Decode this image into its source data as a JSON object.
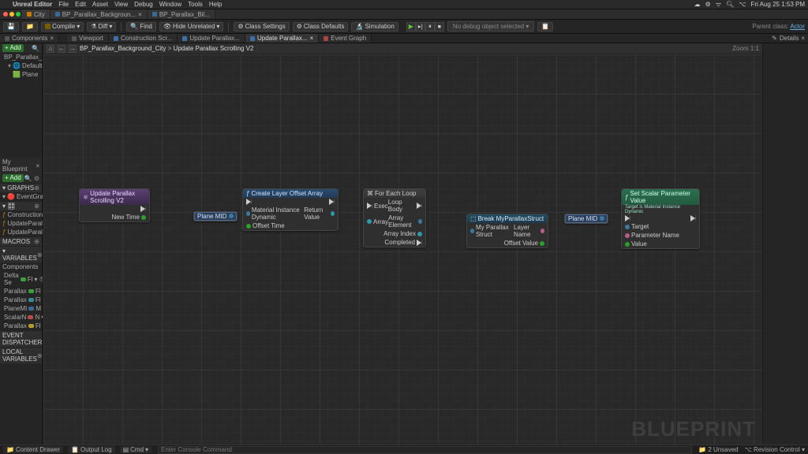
{
  "menubar": {
    "app": "Unreal Editor",
    "items": [
      "File",
      "Edit",
      "Asset",
      "View",
      "Debug",
      "Window",
      "Tools",
      "Help"
    ],
    "right_time": "Fri Aug 25  1:53 PM"
  },
  "tabs": {
    "project": "City",
    "doc1": "BP_Parallax_Backgroun...",
    "doc2": "BP_Parallax_Bil..."
  },
  "toolbar2": {
    "compile": "Compile",
    "diff": "Diff",
    "find": "Find",
    "hide": "Hide Unrelated",
    "class_settings": "Class Settings",
    "class_defaults": "Class Defaults",
    "simulation": "Simulation",
    "dropdown": "No debug object selected",
    "parent_label": "Parent class:",
    "parent_link": "Actor"
  },
  "row_tabs": {
    "components": "Components",
    "viewport": "Viewport",
    "construction": "Construction Scr...",
    "update1": "Update Parallax...",
    "update2": "Update Parallax...",
    "event_graph": "Event Graph",
    "details": "Details"
  },
  "left": {
    "add": "Add",
    "components_hdr": "Components",
    "comp_root": "BP_Parallax_Bac",
    "comp_default": "DefaultScene",
    "comp_plane": "Plane",
    "my_bp": "My Blueprint",
    "cat_graphs": "GRAPHS",
    "graphs_event": "EventGraph",
    "graphs_f": "f",
    "f_construct": "ConstructionSc",
    "f_update1": "UpdateParallax",
    "f_update2": "UpdateParallax",
    "cat_macros": "MACROS",
    "cat_vars": "VARIABLES",
    "cat_comp": "Components",
    "v1": "Delta Se",
    "v2": "Parallax",
    "v3": "Parallax",
    "v4": "PlaneMI",
    "v5": "ScalarN",
    "v6": "Parallax",
    "v1t": "Fl",
    "v2t": "Fl",
    "v3t": "Fl",
    "v4t": "M",
    "v5t": "N",
    "v6t": "Fl",
    "event_dispatch": "EVENT DISPATCHERS",
    "local_vars": "LOCAL VARIABLES"
  },
  "breadcrumb": {
    "root": "BP_Parallax_Background_City",
    "sep": ">",
    "func": "Update Parallax Scrolling V2",
    "zoom": "Zoom 1:1"
  },
  "nodes": {
    "n1_title": "Update Parallax Scrolling V2",
    "n1_pin": "New Time",
    "n2_title": "Create Layer Offset Array",
    "n2_mid": "Material Instance Dynamic",
    "n2_off": "Offset Time",
    "n2_ret": "Return Value",
    "n3_title": "For Each Loop",
    "n3_exec": "Exec",
    "n3_arr": "Array",
    "n3_loop": "Loop Body",
    "n3_elem": "Array Element",
    "n3_idx": "Array Index",
    "n3_comp": "Completed",
    "n4_title": "Break MyParallaxStruct",
    "n4_in": "My Parallax Struct",
    "n4_layer": "Layer Name",
    "n4_off": "Offset Value",
    "n5_title": "Set Scalar Parameter Value",
    "n5_sub": "Target is Material Instance Dynamic",
    "n5_tgt": "Target",
    "n5_param": "Parameter Name",
    "n5_val": "Value",
    "chip": "Plane MID",
    "watermark": "BLUEPRINT"
  },
  "status": {
    "content_drawer": "Content Drawer",
    "output_log": "Output Log",
    "cmd": "Cmd",
    "cmd_placeholder": "Enter Console Command",
    "unsaved": "2 Unsaved",
    "revision": "Revision Control"
  }
}
